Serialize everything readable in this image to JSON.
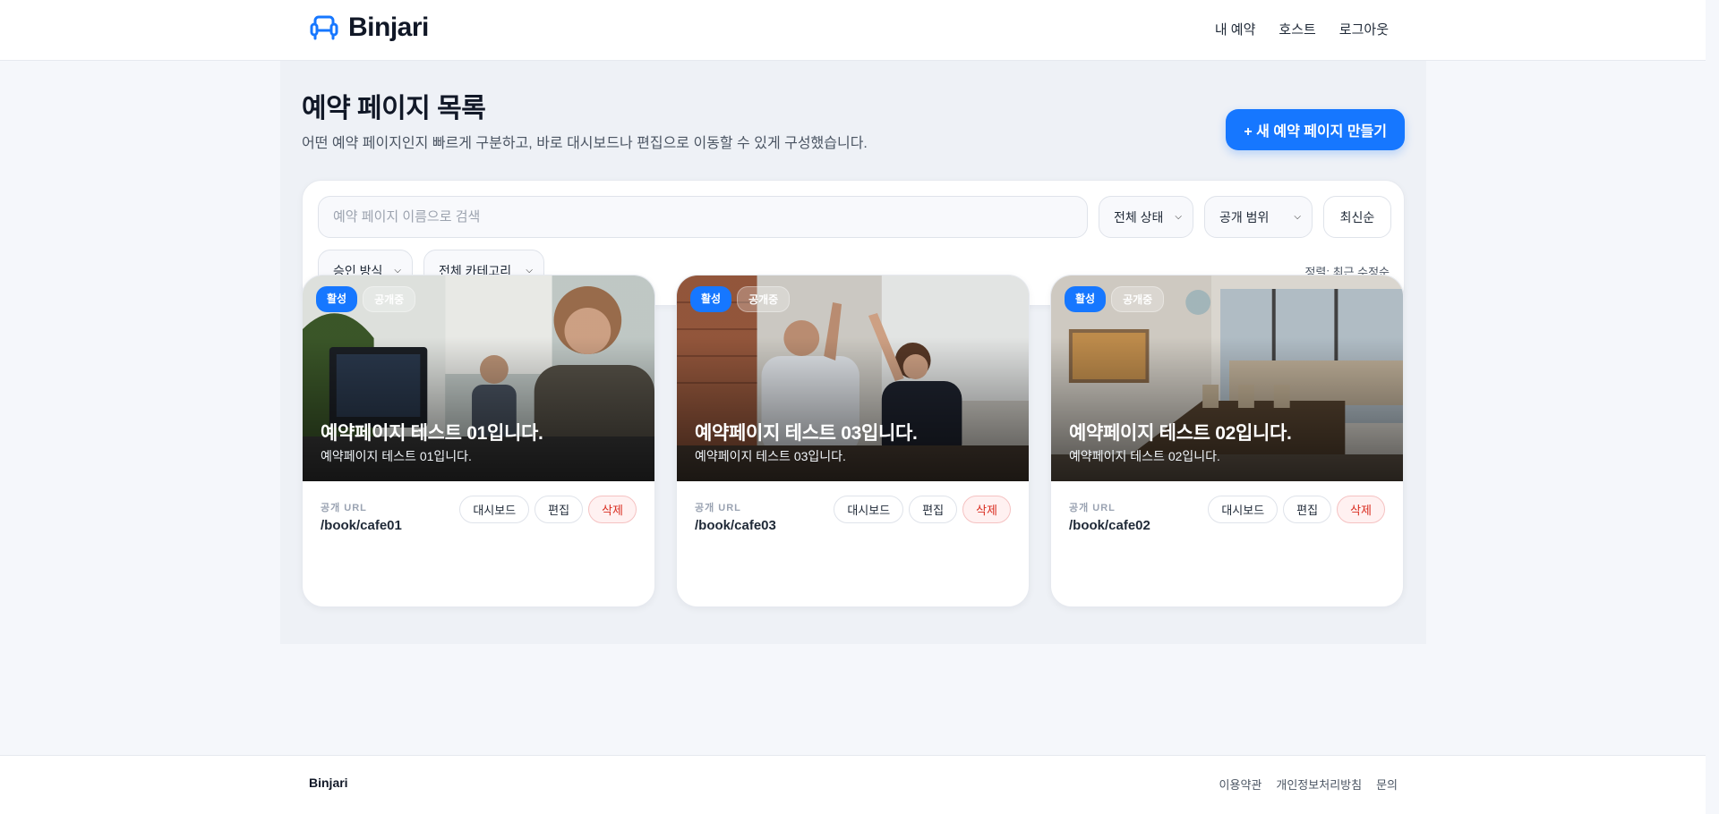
{
  "header": {
    "brand": "Binjari",
    "nav": [
      "내 예약",
      "호스트",
      "로그아웃"
    ]
  },
  "page": {
    "title": "예약 페이지 목록",
    "subtitle": "어떤 예약 페이지인지 빠르게 구분하고, 바로 대시보드나 편집으로 이동할 수 있게 구성했습니다.",
    "new_button": "+ 새 예약 페이지 만들기"
  },
  "filters": {
    "search_placeholder": "예약 페이지 이름으로 검색",
    "status": "전체 상태",
    "visibility": "공개 범위",
    "sort_button": "최신순",
    "approval": "승인 방식",
    "category": "전체 카테고리",
    "sort_label": "정렬: 최근 수정순"
  },
  "cards": [
    {
      "badge_active": "활성",
      "badge_public": "공개중",
      "title": "예약페이지 테스트 01입니다.",
      "desc": "예약페이지 테스트 01입니다.",
      "url_label": "공개 URL",
      "url": "/book/cafe01",
      "btn_dashboard": "대시보드",
      "btn_edit": "편집",
      "btn_delete": "삭제"
    },
    {
      "badge_active": "활성",
      "badge_public": "공개중",
      "title": "예약페이지 테스트 03입니다.",
      "desc": "예약페이지 테스트 03입니다.",
      "url_label": "공개 URL",
      "url": "/book/cafe03",
      "btn_dashboard": "대시보드",
      "btn_edit": "편집",
      "btn_delete": "삭제"
    },
    {
      "badge_active": "활성",
      "badge_public": "공개중",
      "title": "예약페이지 테스트 02입니다.",
      "desc": "예약페이지 테스트 02입니다.",
      "url_label": "공개 URL",
      "url": "/book/cafe02",
      "btn_dashboard": "대시보드",
      "btn_edit": "편집",
      "btn_delete": "삭제"
    }
  ],
  "footer": {
    "brand": "Binjari",
    "links": [
      "이용약관",
      "개인정보처리방침",
      "문의"
    ]
  },
  "colors": {
    "accent": "#1677ff",
    "danger": "#d92d20",
    "background": "#f5f7fb"
  }
}
